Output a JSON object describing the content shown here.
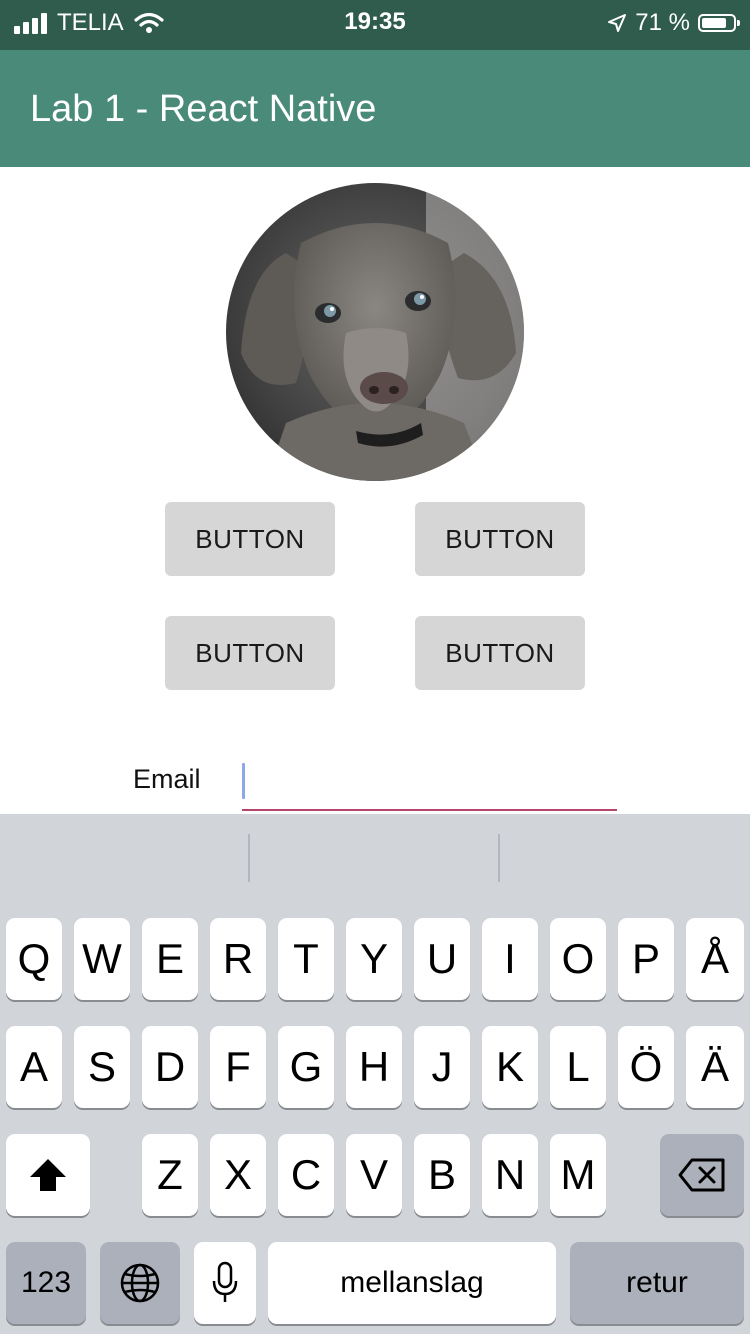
{
  "status_bar": {
    "carrier": "TELIA",
    "time": "19:35",
    "battery_text": "71 %",
    "battery_level": 0.71,
    "icons": [
      "signal-icon",
      "wifi-icon",
      "location-arrow-icon",
      "battery-icon"
    ]
  },
  "app_bar": {
    "title": "Lab 1 - React Native",
    "color": "#4a8a78"
  },
  "avatar": {
    "subject": "grey puppy photo",
    "icon": "dog-photo"
  },
  "buttons": [
    {
      "label": "BUTTON"
    },
    {
      "label": "BUTTON"
    },
    {
      "label": "BUTTON"
    },
    {
      "label": "BUTTON"
    }
  ],
  "email": {
    "label": "Email",
    "value": "",
    "underline_color": "#b5446e"
  },
  "keyboard": {
    "row1": [
      "Q",
      "W",
      "E",
      "R",
      "T",
      "Y",
      "U",
      "I",
      "O",
      "P",
      "Å"
    ],
    "row2": [
      "A",
      "S",
      "D",
      "F",
      "G",
      "H",
      "J",
      "K",
      "L",
      "Ö",
      "Ä"
    ],
    "row3": [
      "Z",
      "X",
      "C",
      "V",
      "B",
      "N",
      "M"
    ],
    "numbers_key": "123",
    "space_key": "mellanslag",
    "return_key": "retur",
    "icons": [
      "shift-icon",
      "backspace-icon",
      "globe-icon",
      "microphone-icon"
    ]
  }
}
